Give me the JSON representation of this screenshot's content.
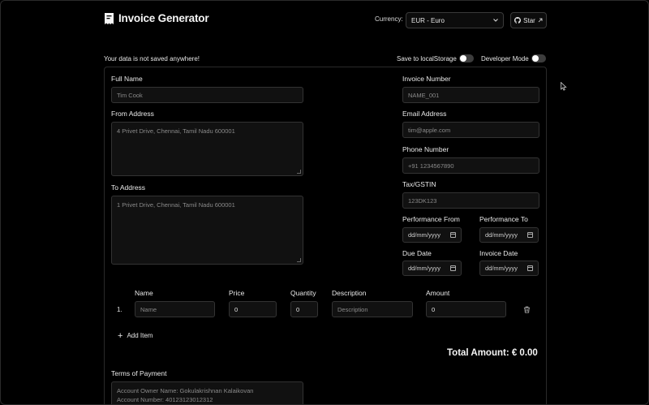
{
  "app": {
    "title": "Invoice Generator"
  },
  "header": {
    "currency_label": "Currency:",
    "currency_value": "EUR - Euro",
    "star_label": "Star"
  },
  "notice": "Your data is not saved anywhere!",
  "toggles": {
    "save_local_label": "Save to localStorage",
    "save_local_on": false,
    "developer_label": "Developer Mode",
    "developer_on": false
  },
  "form": {
    "full_name": {
      "label": "Full Name",
      "placeholder": "Tim Cook"
    },
    "from_address": {
      "label": "From Address",
      "placeholder": "4 Privet Drive, Chennai, Tamil Nadu 600001"
    },
    "to_address": {
      "label": "To Address",
      "placeholder": "1 Privet Drive, Chennai, Tamil Nadu 600001"
    },
    "invoice_number": {
      "label": "Invoice Number",
      "placeholder": "NAME_001"
    },
    "email": {
      "label": "Email Address",
      "placeholder": "tim@apple.com"
    },
    "phone": {
      "label": "Phone Number",
      "placeholder": "+91 1234567890"
    },
    "tax": {
      "label": "Tax/GSTIN",
      "placeholder": "123DK123"
    },
    "performance_from": {
      "label": "Performance From",
      "placeholder": "dd/mm/yyyy"
    },
    "performance_to": {
      "label": "Performance To",
      "placeholder": "dd/mm/yyyy"
    },
    "due_date": {
      "label": "Due Date",
      "placeholder": "dd/mm/yyyy"
    },
    "invoice_date": {
      "label": "Invoice Date",
      "placeholder": "dd/mm/yyyy"
    }
  },
  "items": {
    "headers": {
      "name": "Name",
      "price": "Price",
      "quantity": "Quantity",
      "description": "Description",
      "amount": "Amount"
    },
    "rows": [
      {
        "index": "1.",
        "name_placeholder": "Name",
        "price": "0",
        "quantity": "0",
        "description_placeholder": "Description",
        "amount": "0"
      }
    ],
    "add_label": "Add Item"
  },
  "total": {
    "label": "Total Amount: € 0.00"
  },
  "terms": {
    "label": "Terms of Payment",
    "line1": "Account Owner Name: Gokulakrishnan Kalaikovan",
    "line2": "Account Number: 40123123012312"
  },
  "colors": {
    "background": "#000000",
    "field_bg": "#111111",
    "border": "#333333",
    "text": "#e6e6e6",
    "muted": "#8a8a8a"
  }
}
